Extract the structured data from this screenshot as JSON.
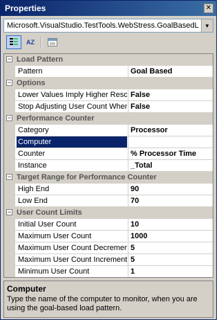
{
  "window": {
    "title": "Properties",
    "close_glyph": "✕"
  },
  "object_selector": {
    "value": "Microsoft.VisualStudio.TestTools.WebStress.GoalBasedLoadPattern",
    "arrow_glyph": "▼"
  },
  "toolbar": {
    "sort_categorized_label": "Categorized",
    "sort_alphabetical_label": "AZ",
    "pages_label": "Property Pages"
  },
  "grid": {
    "categories": [
      {
        "name": "Load Pattern",
        "expanded": true,
        "properties": [
          {
            "name": "Pattern",
            "value": "Goal Based"
          }
        ]
      },
      {
        "name": "Options",
        "expanded": true,
        "properties": [
          {
            "name": "Lower Values Imply Higher Resource Utilization",
            "value": "False"
          },
          {
            "name": "Stop Adjusting User Count When Goal Achieved",
            "value": "False"
          }
        ]
      },
      {
        "name": "Performance Counter",
        "expanded": true,
        "properties": [
          {
            "name": "Category",
            "value": "Processor"
          },
          {
            "name": "Computer",
            "value": "",
            "selected": true
          },
          {
            "name": "Counter",
            "value": "% Processor Time"
          },
          {
            "name": "Instance",
            "value": "_Total"
          }
        ]
      },
      {
        "name": "Target Range for Performance Counter",
        "expanded": true,
        "properties": [
          {
            "name": "High End",
            "value": "90"
          },
          {
            "name": "Low End",
            "value": "70"
          }
        ]
      },
      {
        "name": "User Count Limits",
        "expanded": true,
        "properties": [
          {
            "name": "Initial User Count",
            "value": "10"
          },
          {
            "name": "Maximum User Count",
            "value": "1000"
          },
          {
            "name": "Maximum User Count Decrement",
            "value": "5"
          },
          {
            "name": "Maximum User Count Increment",
            "value": "5"
          },
          {
            "name": "Minimum User Count",
            "value": "1"
          }
        ]
      }
    ],
    "collapse_glyph": "−"
  },
  "description": {
    "title": "Computer",
    "text": "Type the name of the computer to monitor, when you are using the goal-based load pattern."
  }
}
